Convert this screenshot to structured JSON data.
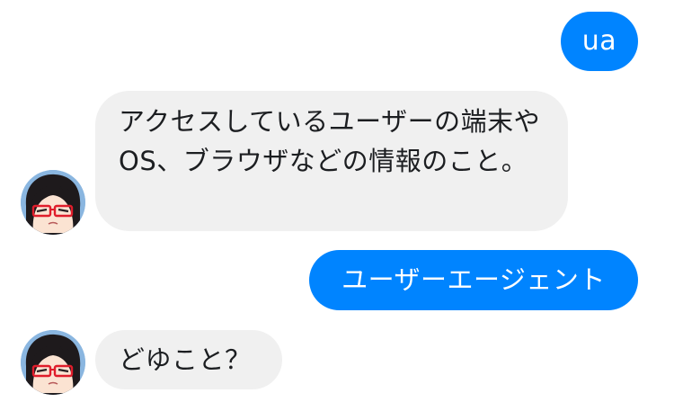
{
  "messages": [
    {
      "side": "sent",
      "text": "ua"
    },
    {
      "side": "received",
      "text": "アクセスしているユーザーの端末やOS、ブラウザなどの情報のこと。"
    },
    {
      "side": "sent",
      "text": "ユーザーエージェント"
    },
    {
      "side": "received",
      "text": "どゆこと？"
    }
  ],
  "icons": {
    "avatar": "girl-with-glasses-avatar-icon"
  },
  "colors": {
    "sent_bubble": "#0084ff",
    "received_bubble": "#f0f0f0",
    "sent_text": "#ffffff",
    "received_text": "#1c1e21"
  }
}
